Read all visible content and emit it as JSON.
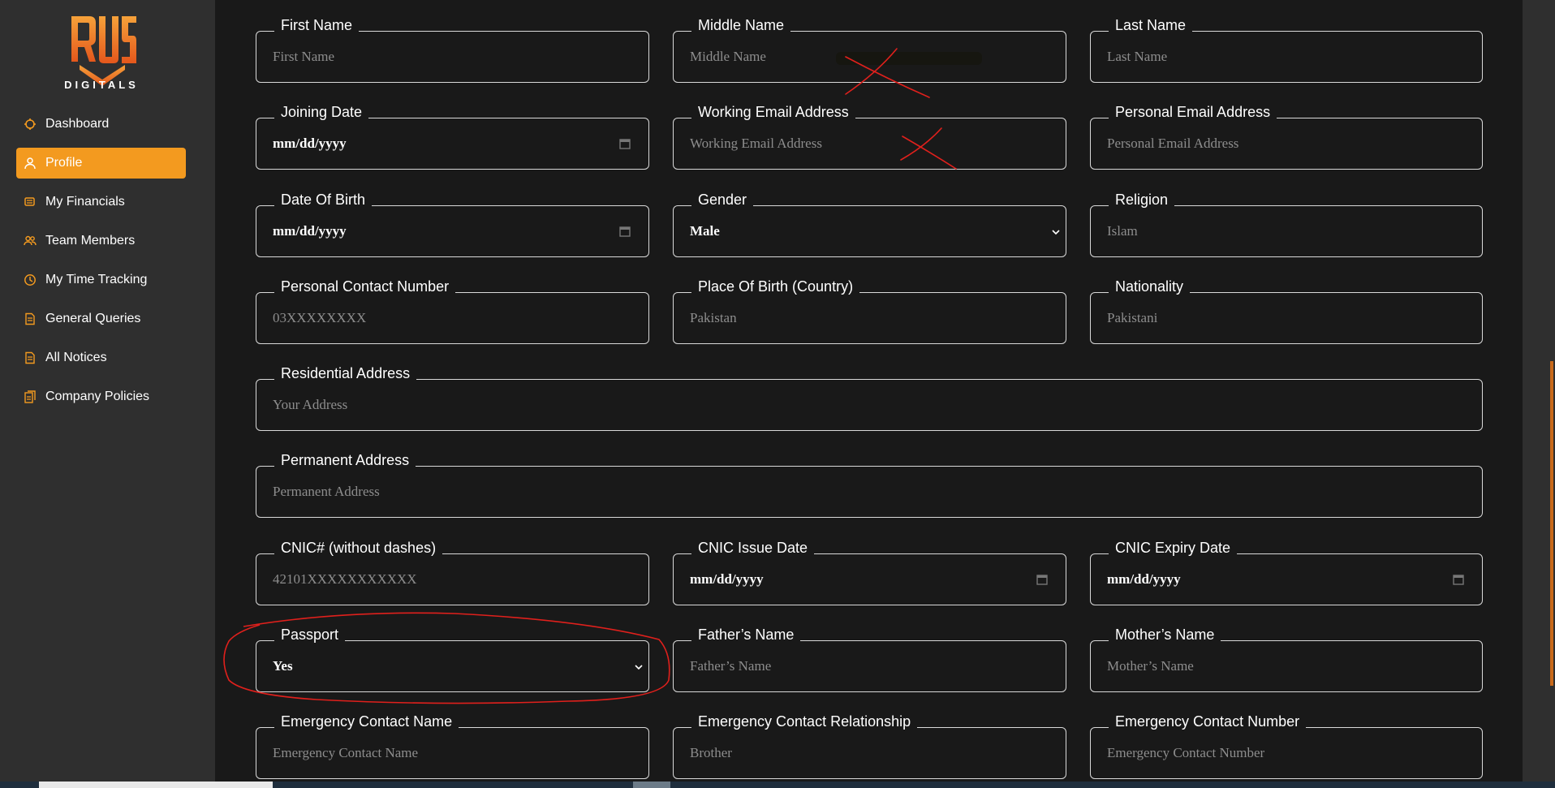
{
  "brand": {
    "logo_text": "DIGITALS",
    "accent": "#f39a1f"
  },
  "sidebar": {
    "items": [
      {
        "label": "Dashboard",
        "icon": "dashboard-icon",
        "active": false
      },
      {
        "label": "Profile",
        "icon": "user-icon",
        "active": true
      },
      {
        "label": "My Financials",
        "icon": "financials-icon",
        "active": false
      },
      {
        "label": "Team Members",
        "icon": "team-icon",
        "active": false
      },
      {
        "label": "My Time Tracking",
        "icon": "clock-icon",
        "active": false
      },
      {
        "label": "General Queries",
        "icon": "document-icon",
        "active": false
      },
      {
        "label": "All Notices",
        "icon": "document-icon",
        "active": false
      },
      {
        "label": "Company Policies",
        "icon": "policies-icon",
        "active": false
      }
    ]
  },
  "form": {
    "first_name": {
      "label": "First Name",
      "placeholder": "First Name"
    },
    "middle_name": {
      "label": "Middle Name",
      "placeholder": "Middle Name"
    },
    "last_name": {
      "label": "Last Name",
      "placeholder": "Last Name"
    },
    "joining_date": {
      "label": "Joining Date",
      "value": "mm/dd/yyyy"
    },
    "working_email": {
      "label": "Working Email Address",
      "placeholder": "Working Email Address"
    },
    "personal_email": {
      "label": "Personal Email Address",
      "placeholder": "Personal Email Address"
    },
    "date_of_birth": {
      "label": "Date Of Birth",
      "value": "mm/dd/yyyy"
    },
    "gender": {
      "label": "Gender",
      "value": "Male"
    },
    "religion": {
      "label": "Religion",
      "placeholder": "Islam"
    },
    "personal_contact": {
      "label": "Personal Contact Number",
      "placeholder": "03XXXXXXXX"
    },
    "place_of_birth": {
      "label": "Place Of Birth (Country)",
      "placeholder": "Pakistan"
    },
    "nationality": {
      "label": "Nationality",
      "placeholder": "Pakistani"
    },
    "residential_address": {
      "label": "Residential Address",
      "placeholder": "Your Address"
    },
    "permanent_address": {
      "label": "Permanent Address",
      "placeholder": "Permanent Address"
    },
    "cnic": {
      "label": "CNIC# (without dashes)",
      "placeholder": "42101XXXXXXXXXXX"
    },
    "cnic_issue": {
      "label": "CNIC Issue Date",
      "value": "mm/dd/yyyy"
    },
    "cnic_expiry": {
      "label": "CNIC Expiry Date",
      "value": "mm/dd/yyyy"
    },
    "passport": {
      "label": "Passport",
      "value": "Yes"
    },
    "father_name": {
      "label": "Father’s Name",
      "placeholder": "Father’s Name"
    },
    "mother_name": {
      "label": "Mother’s Name",
      "placeholder": "Mother’s Name"
    },
    "emergency_name": {
      "label": "Emergency Contact Name",
      "placeholder": "Emergency Contact Name"
    },
    "emergency_relationship": {
      "label": "Emergency Contact Relationship",
      "placeholder": "Brother"
    },
    "emergency_number": {
      "label": "Emergency Contact Number",
      "placeholder": "Emergency Contact Number"
    }
  },
  "annotation_color": "#e0201c"
}
